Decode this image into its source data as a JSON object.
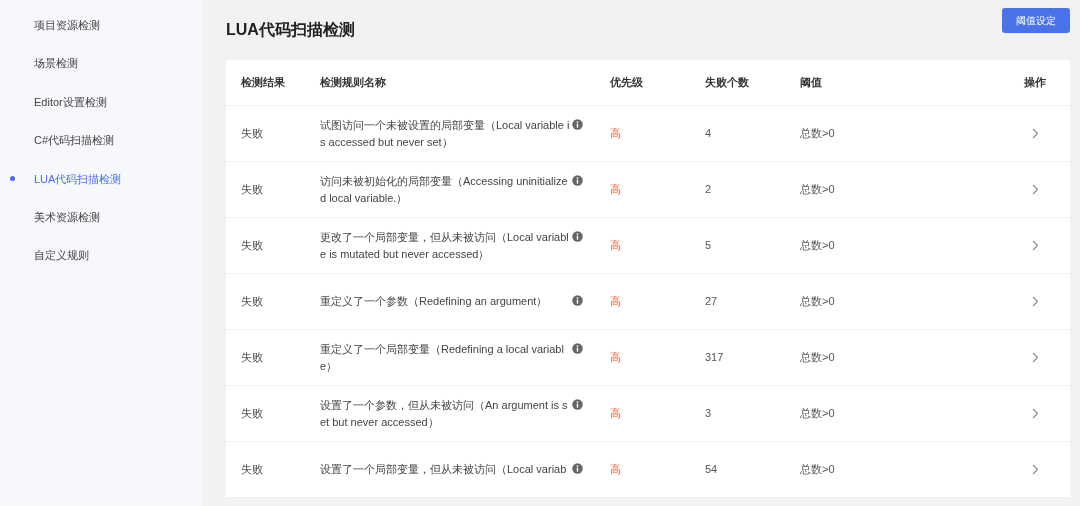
{
  "sidebar": {
    "items": [
      {
        "label": "项目资源检测",
        "selected": false
      },
      {
        "label": "场景检测",
        "selected": false
      },
      {
        "label": "Editor设置检测",
        "selected": false
      },
      {
        "label": "C#代码扫描检测",
        "selected": false
      },
      {
        "label": "LUA代码扫描检测",
        "selected": true
      },
      {
        "label": "美术资源检测",
        "selected": false
      },
      {
        "label": "自定义规则",
        "selected": false
      }
    ]
  },
  "page": {
    "title": "LUA代码扫描检测",
    "threshold_button": "阈值设定"
  },
  "table": {
    "columns": [
      "检测结果",
      "检测规则名称",
      "优先级",
      "失败个数",
      "阈值",
      "操作"
    ],
    "rows": [
      {
        "result": "失败",
        "rule": "试图访问一个未被设置的局部变量（Local variable is accessed but never set）",
        "priority": "高",
        "count": "4",
        "threshold": "总数>0"
      },
      {
        "result": "失败",
        "rule": "访问未被初始化的局部变量（Accessing uninitialized local variable.）",
        "priority": "高",
        "count": "2",
        "threshold": "总数>0"
      },
      {
        "result": "失败",
        "rule": "更改了一个局部变量，但从未被访问（Local variable is mutated but never accessed）",
        "priority": "高",
        "count": "5",
        "threshold": "总数>0"
      },
      {
        "result": "失败",
        "rule": "重定义了一个参数（Redefining an argument）",
        "priority": "高",
        "count": "27",
        "threshold": "总数>0"
      },
      {
        "result": "失败",
        "rule": "重定义了一个局部变量（Redefining a local variable）",
        "priority": "高",
        "count": "317",
        "threshold": "总数>0"
      },
      {
        "result": "失败",
        "rule": "设置了一个参数，但从未被访问（An argument is set but never accessed）",
        "priority": "高",
        "count": "3",
        "threshold": "总数>0"
      },
      {
        "result": "失败",
        "rule": "设置了一个局部变量，但从未被访问（Local variab",
        "priority": "高",
        "count": "54",
        "threshold": "总数>0"
      }
    ]
  }
}
